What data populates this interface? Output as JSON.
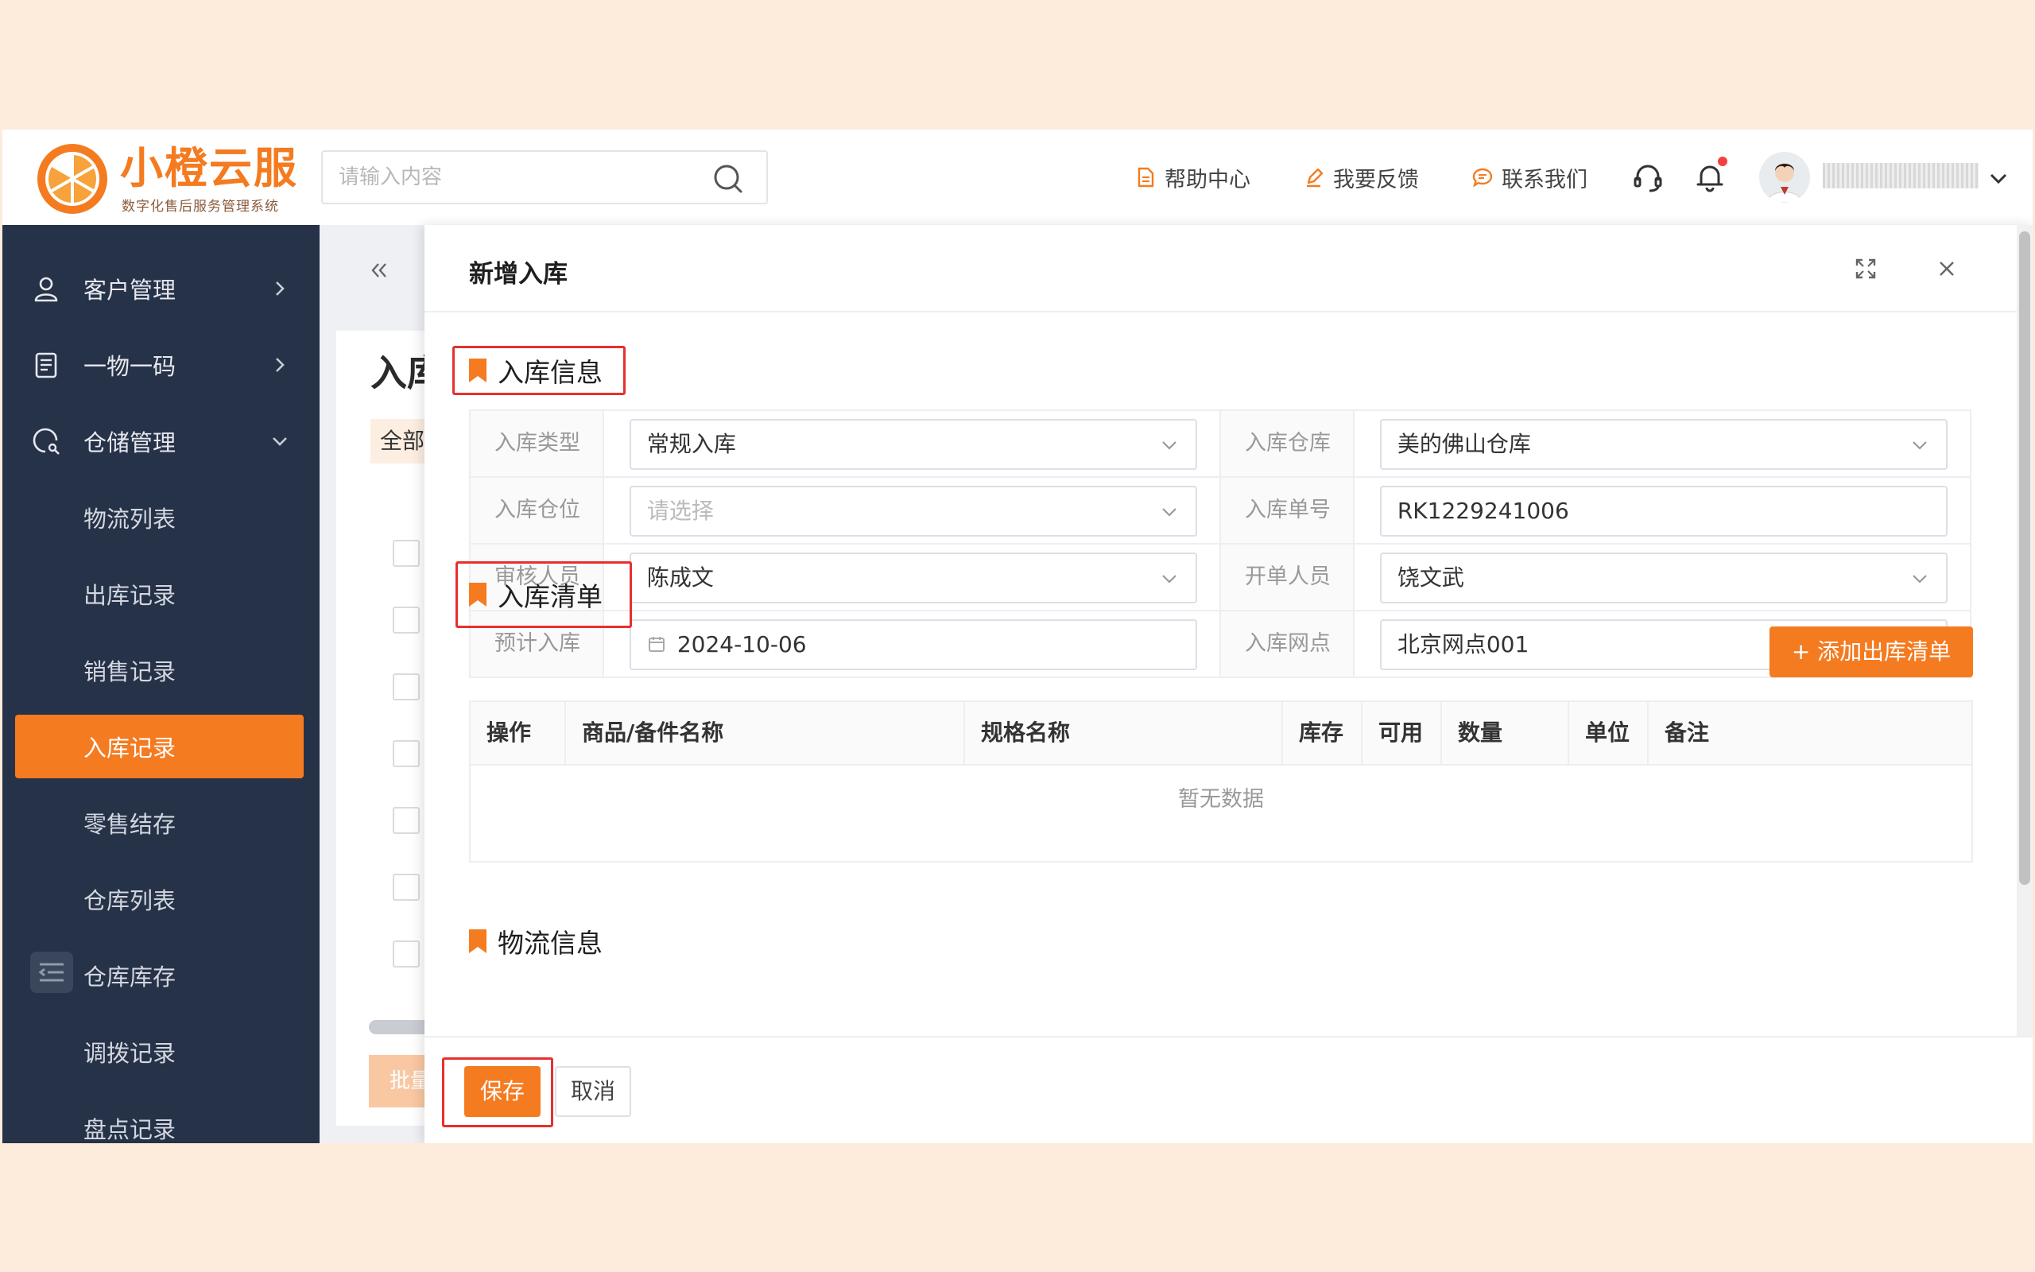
{
  "brand": {
    "name": "小橙云服",
    "tagline": "数字化售后服务管理系统",
    "accent": "#f47b20"
  },
  "header": {
    "search_placeholder": "请输入内容",
    "links": [
      {
        "label": "帮助中心",
        "icon": "document-icon"
      },
      {
        "label": "我要反馈",
        "icon": "pencil-icon"
      },
      {
        "label": "联系我们",
        "icon": "chat-icon"
      }
    ],
    "username": "■■■■■■■■■■"
  },
  "sidebar": {
    "groups": [
      {
        "label": "客户管理",
        "icon": "user-icon"
      },
      {
        "label": "一物一码",
        "icon": "clipboard-icon"
      },
      {
        "label": "仓储管理",
        "icon": "warehouse-search-icon"
      }
    ],
    "sub_items": [
      "物流列表",
      "出库记录",
      "销售记录",
      "入库记录",
      "零售结存",
      "仓库列表",
      "仓库库存",
      "调拨记录",
      "盘点记录"
    ],
    "active": "入库记录"
  },
  "background": {
    "title": "入库",
    "tab": "全部",
    "batch_button": "批量"
  },
  "modal": {
    "title": "新增入库",
    "section_info": "入库信息",
    "form": [
      {
        "label": "入库类型",
        "value": "常规入库",
        "placeholder": false,
        "dropdown": true
      },
      {
        "label": "入库仓库",
        "value": "美的佛山仓库",
        "placeholder": false,
        "dropdown": true
      },
      {
        "label": "入库仓位",
        "value": "请选择",
        "placeholder": true,
        "dropdown": true
      },
      {
        "label": "入库单号",
        "value": "RK1229241006",
        "placeholder": false,
        "dropdown": false
      },
      {
        "label": "审核人员",
        "value": "陈成文",
        "placeholder": false,
        "dropdown": true
      },
      {
        "label": "开单人员",
        "value": "饶文武",
        "placeholder": false,
        "dropdown": true
      },
      {
        "label": "预计入库",
        "value": "2024-10-06",
        "placeholder": false,
        "dropdown": false,
        "date": true
      },
      {
        "label": "入库网点",
        "value": "北京网点001",
        "placeholder": false,
        "dropdown": true
      }
    ],
    "section_list": "入库清单",
    "add_button": "+ 添加出库清单",
    "table_columns": [
      "操作",
      "商品/备件名称",
      "规格名称",
      "库存",
      "可用",
      "数量",
      "单位",
      "备注"
    ],
    "empty_text": "暂无数据",
    "section_logistics": "物流信息",
    "save_button": "保存",
    "cancel_button": "取消"
  }
}
